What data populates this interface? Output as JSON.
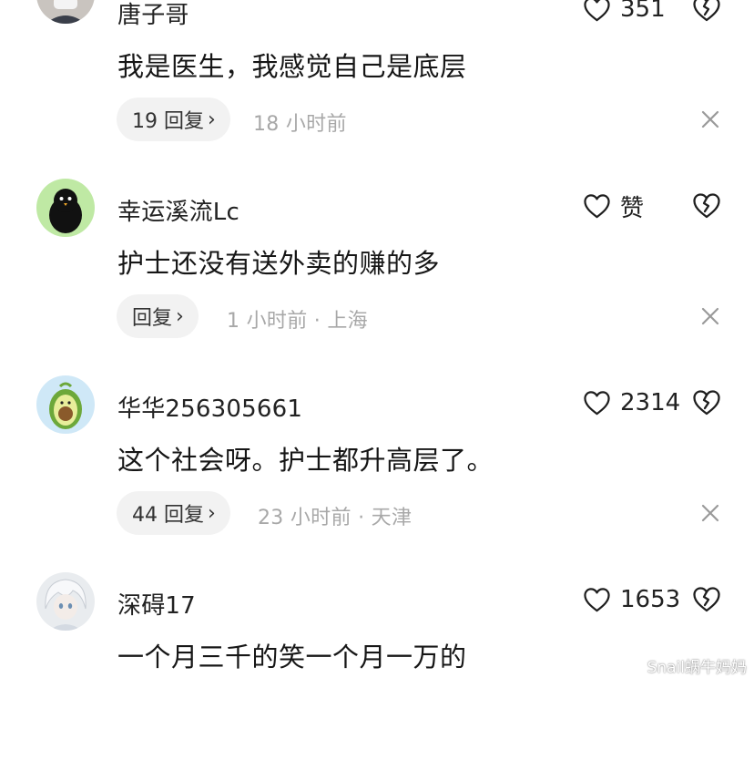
{
  "comments": [
    {
      "username": "唐子哥",
      "content": "我是医生，我感觉自己是底层",
      "reply_label": "19 回复",
      "time": "18 小时前",
      "location": "",
      "like_count": "351",
      "avatar": "man-with-mask-avatar"
    },
    {
      "username": "幸运溪流Lc",
      "content": "护士还没有送外卖的赚的多",
      "reply_label": "回复",
      "time": "1 小时前 · 上海",
      "location": "",
      "like_count": "赞",
      "avatar": "black-bird-avatar"
    },
    {
      "username": "华华256305661",
      "content": "这个社会呀。护士都升高层了。",
      "reply_label": "44 回复",
      "time": "23 小时前 · 天津",
      "location": "",
      "like_count": "2314",
      "avatar": "avocado-avatar"
    },
    {
      "username": "深碍17",
      "content": "一个月三千的笑一个月一万的",
      "reply_label": "",
      "time": "",
      "location": "",
      "like_count": "1653",
      "avatar": "anime-white-hair-avatar"
    }
  ],
  "icons": {
    "like": "heart-outline-icon",
    "dislike": "broken-heart-icon",
    "close": "close-icon",
    "reply_chevron": "chevron-right-icon"
  },
  "chevron": "›",
  "watermark": "Snail蜗牛妈妈"
}
